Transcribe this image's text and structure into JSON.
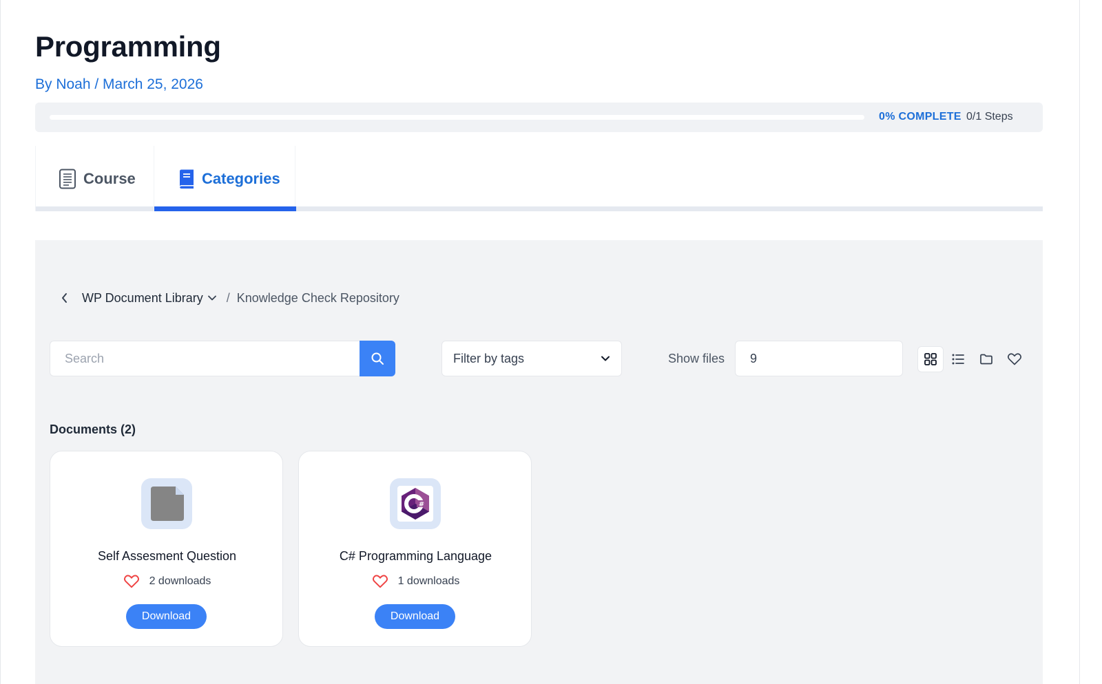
{
  "page": {
    "title": "Programming",
    "byline": "By Noah / March 25, 2026"
  },
  "progress": {
    "percent": 0,
    "percent_label": "0% COMPLETE",
    "steps_label": "0/1 Steps"
  },
  "tabs": [
    {
      "label": "Course",
      "icon": "document-icon",
      "active": false
    },
    {
      "label": "Categories",
      "icon": "book-icon",
      "active": true
    }
  ],
  "breadcrumb": {
    "library": "WP Document Library",
    "separator": "/",
    "current": "Knowledge Check Repository"
  },
  "search": {
    "placeholder": "Search",
    "value": ""
  },
  "filter": {
    "selected": "Filter by tags"
  },
  "show_files": {
    "label": "Show files",
    "value": "9"
  },
  "view_modes": [
    "grid-view-icon",
    "list-view-icon",
    "folder-icon",
    "heart-icon"
  ],
  "documents": {
    "heading": "Documents (2)",
    "items": [
      {
        "name": "Self Assesment Question",
        "downloads": "2 downloads",
        "button": "Download",
        "icon": "generic-file-icon"
      },
      {
        "name": "C# Programming Language",
        "downloads": "1 downloads",
        "button": "Download",
        "icon": "csharp-logo-icon"
      }
    ]
  },
  "colors": {
    "accent": "#2563eb",
    "button": "#3b82f6",
    "link": "#1d6fd8",
    "heart": "#ef4444",
    "panel": "#f2f3f5"
  }
}
